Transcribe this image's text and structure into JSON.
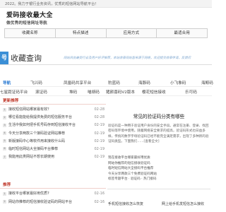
{
  "topbar": {
    "notice": "2022。我力于银行业务资讯，优秀的短信网站导航平台！"
  },
  "logo": {
    "title": "爱码接收最大全",
    "subtitle": "做优秀的短信网址导航"
  },
  "nav": {
    "cells": [
      "收藏名称",
      "特点描述",
      "应用方式",
      "最适合用"
    ]
  },
  "section": {
    "icon": "号",
    "title": "收藏查询",
    "description": "网站目前最受行业及用户好评推荐，本站收录网站皆来源于网络，欢迎提交收录申请，反馈问"
  },
  "categories": {
    "row1": [
      "导航",
      "飞兴码",
      "凤凰码共享平台",
      "豹蓝码",
      "海豚码",
      "小飞象码",
      "海鲸码"
    ],
    "row2": [
      "七星距证码平台",
      "滚证码",
      "堆码",
      "喵胡码",
      "猪颜喜码V2版本",
      "樱花短信接收",
      "乐可码"
    ]
  },
  "left": {
    "hot_title": "更新推荐",
    "hot_list": [
      {
        "num": "1",
        "text": "接收短信网站哪家最有效？",
        "date": "02-28"
      },
      {
        "num": "2",
        "text": "哪位看能能给我提供免费的短信服务平台",
        "date": "02-28"
      },
      {
        "num": "3",
        "text": "生活中我如何把手机号码存到短信接收平台",
        "date": "02-19"
      },
      {
        "num": "4",
        "text": "今天分享两款三个接码验证网站推荐",
        "date": "02-19"
      },
      {
        "num": "5",
        "text": "新版接码中心等软件用来接收什么码",
        "date": "02-19"
      },
      {
        "num": "6",
        "text": "临时短信网站大全接码平台推荐",
        "date": "02-19"
      },
      {
        "num": "7",
        "text": "我能用此类网站不想长期使用",
        "date": "02-19"
      }
    ],
    "hot_title2": "推荐",
    "hot_list2": [
      {
        "num": "1",
        "text": "接收平台哪家最好用优质?",
        "date": "02-16"
      },
      {
        "num": "2",
        "text": "网站你推荐的短信接收验证码的网站平台",
        "date": "02-16"
      }
    ]
  },
  "right": {
    "article_title": "常见的验证码分类有哪些",
    "article_body": "验证码是一种用于验证用户身份的安全手段。通常在注册、登录、找回密码等环境中使用。随着网络安全要求的提高，验证码形式也日益多样，传统的数字字母验证码已经不能完全满足需求，出现了多种新的验证码类型。下面我们……[查看全文]",
    "link_list": [
      "现在接收平台哪家最好用优质",
      "网站你推荐的短信接收验证码",
      "临时短信网站大全接码平台推荐",
      "今天分享两款三个免费验证码网站"
    ],
    "tail": "标签专题平台 · 验证码 · 热门接码",
    "bottom_left": "手机短信接收怎么恢复",
    "bottom_right": "网上给手机发短信怎么接收"
  }
}
